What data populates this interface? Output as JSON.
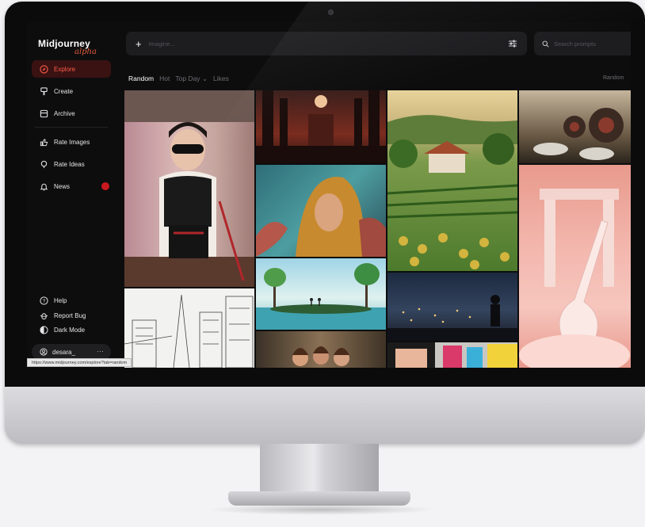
{
  "sidebar": {
    "logo": {
      "title": "Midjourney",
      "badge": "alpha"
    },
    "nav_top": [
      {
        "label": "Explore",
        "icon": "compass-icon",
        "active": true
      },
      {
        "label": "Create",
        "icon": "brush-icon",
        "active": false
      },
      {
        "label": "Archive",
        "icon": "archive-icon",
        "active": false
      }
    ],
    "nav_mid": [
      {
        "label": "Rate Images",
        "icon": "thumbs-up-icon"
      },
      {
        "label": "Rate Ideas",
        "icon": "lightbulb-icon"
      },
      {
        "label": "News",
        "icon": "bell-icon"
      }
    ],
    "nav_bottom": [
      {
        "label": "Help",
        "icon": "help-icon"
      },
      {
        "label": "Report Bug",
        "icon": "bug-icon"
      },
      {
        "label": "Dark Mode",
        "icon": "moon-icon"
      }
    ],
    "user": {
      "name": "desara_",
      "more": "···"
    }
  },
  "status_url": "https://www.midjourney.com/explore?tab=random",
  "topbar": {
    "imagine_placeholder": "Imagine...",
    "search_placeholder": "Search prompts"
  },
  "tabs": [
    "Random",
    "Hot",
    "Top Day ⌄",
    "Likes"
  ],
  "sort_label": "Random",
  "colors": {
    "accent": "#ff5a4a",
    "active_bg": "#3a1212",
    "badge": "#c9191e"
  },
  "gallery": [
    {
      "name": "gallery-image-boy-in-mask"
    },
    {
      "name": "gallery-image-sketch-city"
    },
    {
      "name": "gallery-image-dark-cathedral"
    },
    {
      "name": "gallery-image-hooded-woman"
    },
    {
      "name": "gallery-image-runners-landscape"
    },
    {
      "name": "gallery-image-three-women"
    },
    {
      "name": "gallery-image-vineyard-house"
    },
    {
      "name": "gallery-image-night-city-figure"
    },
    {
      "name": "gallery-image-pop-art"
    },
    {
      "name": "gallery-image-vinyl-speakers"
    },
    {
      "name": "gallery-image-pink-violin"
    }
  ]
}
